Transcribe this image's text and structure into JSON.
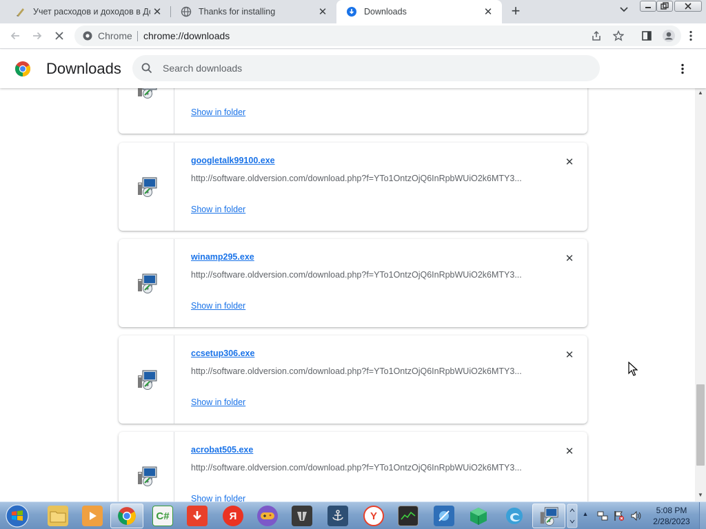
{
  "browser": {
    "tabs": [
      {
        "title": "Учет расходов и доходов в Дом",
        "favicon": "pencil-favicon",
        "active": false
      },
      {
        "title": "Thanks for installing",
        "favicon": "globe-favicon",
        "active": false
      },
      {
        "title": "Downloads",
        "favicon": "download-favicon",
        "active": true
      }
    ],
    "new_tab_label": "+",
    "omnibox": {
      "site_label": "Chrome",
      "url": "chrome://downloads"
    }
  },
  "downloads_page": {
    "title": "Downloads",
    "search": {
      "placeholder": "Search downloads",
      "value": ""
    },
    "items": [
      {
        "filename": "",
        "url": "",
        "action": "Show in folder",
        "icon": "installer-icon"
      },
      {
        "filename": "googletalk99100.exe",
        "url": "http://software.oldversion.com/download.php?f=YTo1OntzOjQ6InRpbWUiO2k6MTY3...",
        "action": "Show in folder",
        "icon": "installer-icon"
      },
      {
        "filename": "winamp295.exe",
        "url": "http://software.oldversion.com/download.php?f=YTo1OntzOjQ6InRpbWUiO2k6MTY3...",
        "action": "Show in folder",
        "icon": "installer-icon"
      },
      {
        "filename": "ccsetup306.exe",
        "url": "http://software.oldversion.com/download.php?f=YTo1OntzOjQ6InRpbWUiO2k6MTY3...",
        "action": "Show in folder",
        "icon": "installer-icon"
      },
      {
        "filename": "acrobat505.exe",
        "url": "http://software.oldversion.com/download.php?f=YTo1OntzOjQ6InRpbWUiO2k6MTY3...",
        "action": "Show in folder",
        "icon": "installer-icon"
      }
    ]
  },
  "taskbar": {
    "apps": [
      {
        "name": "explorer",
        "label": "",
        "color": "#e8c35a"
      },
      {
        "name": "media-player",
        "label": "",
        "color": "#f0a040"
      },
      {
        "name": "chrome",
        "label": "",
        "color": "#4285f4"
      },
      {
        "name": "csharp",
        "label": "C#",
        "color": "#3a9a3a"
      },
      {
        "name": "downloader",
        "label": "",
        "color": "#e8402a"
      },
      {
        "name": "yandex",
        "label": "Я",
        "color": "#ea3323"
      },
      {
        "name": "gamepad",
        "label": "",
        "color": "#7c59c8"
      },
      {
        "name": "world-of-tanks",
        "label": "",
        "color": "#3a3a3a"
      },
      {
        "name": "world-of-warships",
        "label": "",
        "color": "#2d4e73"
      },
      {
        "name": "yandex-browser",
        "label": "Y",
        "color": "#e8402a"
      },
      {
        "name": "task-manager",
        "label": "",
        "color": "#3f6e3a"
      },
      {
        "name": "network-tool",
        "label": "",
        "color": "#2f6fb8"
      },
      {
        "name": "3d-box",
        "label": "",
        "color": "#1fa35b"
      },
      {
        "name": "edge",
        "label": "",
        "color": "#3aa0d8"
      },
      {
        "name": "installer",
        "label": "",
        "color": "#4a7cc0"
      }
    ],
    "clock": {
      "time": "5:08 PM",
      "date": "2/28/2023"
    }
  }
}
